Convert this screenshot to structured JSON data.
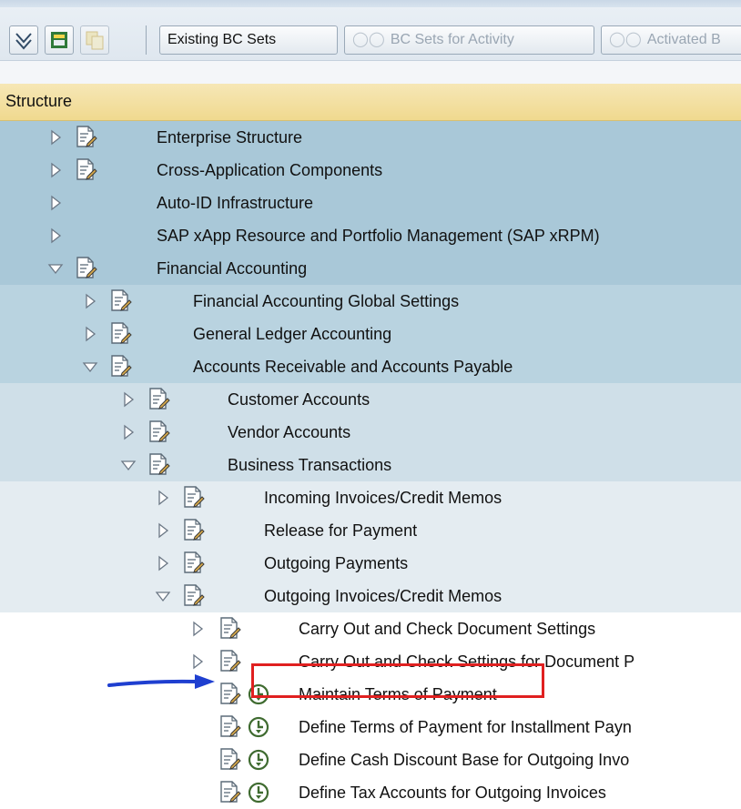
{
  "toolbar": {
    "buttons": [
      {
        "label": "Existing BC Sets",
        "enabled": true
      },
      {
        "label": "BC Sets for Activity",
        "enabled": false
      },
      {
        "label": "Activated B",
        "enabled": false
      }
    ]
  },
  "tree": {
    "header": "Structure",
    "rows": [
      {
        "label": "Enterprise Structure"
      },
      {
        "label": "Cross-Application Components"
      },
      {
        "label": "Auto-ID Infrastructure"
      },
      {
        "label": "SAP xApp Resource and Portfolio Management (SAP xRPM)"
      },
      {
        "label": "Financial Accounting"
      },
      {
        "label": "Financial Accounting Global Settings"
      },
      {
        "label": "General Ledger Accounting"
      },
      {
        "label": "Accounts Receivable and Accounts Payable"
      },
      {
        "label": "Customer Accounts"
      },
      {
        "label": "Vendor Accounts"
      },
      {
        "label": "Business Transactions"
      },
      {
        "label": "Incoming Invoices/Credit Memos"
      },
      {
        "label": "Release for Payment"
      },
      {
        "label": "Outgoing Payments"
      },
      {
        "label": "Outgoing Invoices/Credit Memos"
      },
      {
        "label": "Carry Out and Check Document Settings"
      },
      {
        "label": "Carry Out and Check Settings for Document P"
      },
      {
        "label": "Maintain Terms of Payment"
      },
      {
        "label": "Define Terms of Payment for Installment Payn"
      },
      {
        "label": "Define Cash Discount Base for Outgoing Invo"
      },
      {
        "label": "Define Tax Accounts for Outgoing Invoices"
      }
    ]
  },
  "colors": {
    "highlight": "#e02020",
    "arrow": "#1f3fd0",
    "header": "#f0d98f"
  }
}
